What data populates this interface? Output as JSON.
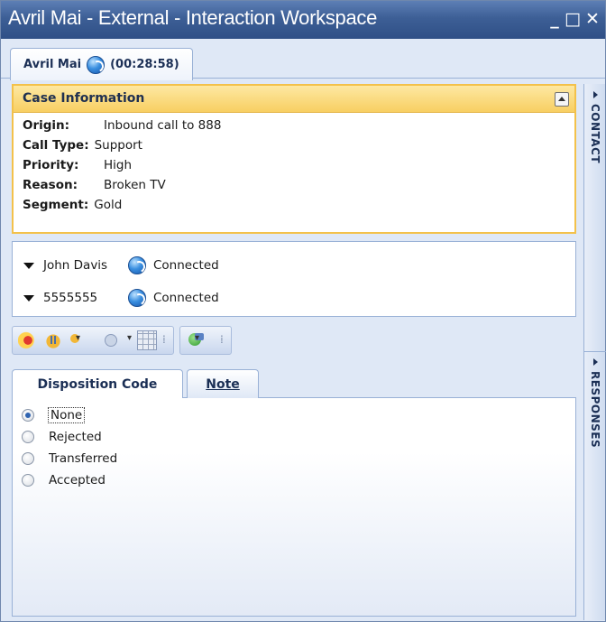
{
  "window": {
    "title": "Avril Mai - External - Interaction Workspace",
    "buttons": {
      "minimize": "_",
      "maximize": "□",
      "close": "✕"
    }
  },
  "interaction_tab": {
    "name": "Avril Mai",
    "timer": "(00:28:58)",
    "icon": "globe-icon"
  },
  "case_information": {
    "title": "Case Information",
    "fields": [
      {
        "key": "Origin:",
        "value": "Inbound call to 888"
      },
      {
        "key": "Call Type:",
        "value": "Support"
      },
      {
        "key": "Priority:",
        "value": "High"
      },
      {
        "key": "Reason:",
        "value": "Broken TV"
      },
      {
        "key": "Segment:",
        "value": "Gold"
      }
    ]
  },
  "parties": [
    {
      "name": "John Davis",
      "status": "Connected"
    },
    {
      "name": "5555555",
      "status": "Connected"
    }
  ],
  "toolbar": {
    "icons": [
      "release-call-icon",
      "hold-call-icon",
      "transfer-call-icon",
      "conference-call-icon",
      "keypad-icon",
      "record-icon"
    ]
  },
  "tabs": [
    {
      "label": "Disposition Code",
      "active": true
    },
    {
      "label": "Note",
      "active": false
    }
  ],
  "disposition": {
    "options": [
      "None",
      "Rejected",
      "Transferred",
      "Accepted"
    ],
    "selected": "None"
  },
  "side_panel": {
    "tabs": [
      "CONTACT",
      "RESPONSES"
    ]
  },
  "colors": {
    "titlebar": "#3d5f96",
    "case_border": "#f3c14a",
    "case_header": "#f8cf62",
    "panel_border": "#99b1d6",
    "background": "#dfe8f6"
  }
}
